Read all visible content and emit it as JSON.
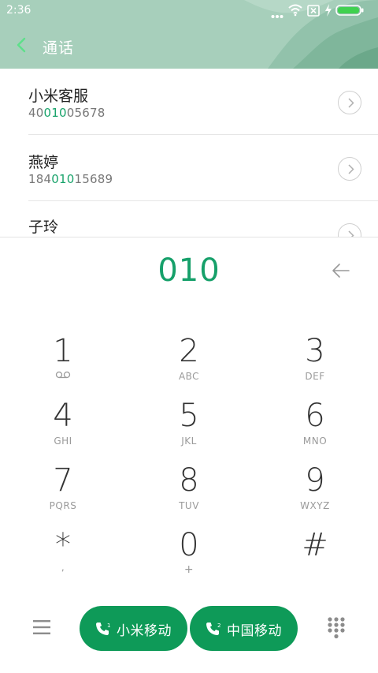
{
  "status_bar": {
    "time": "2:36",
    "icons": [
      "more-dots-icon",
      "wifi-icon",
      "sim-disabled-icon",
      "charging-bolt-icon",
      "battery-icon"
    ]
  },
  "header": {
    "title": "通话",
    "back_icon": "chevron-left-icon",
    "accent_color": "#a7cfbb"
  },
  "contacts": [
    {
      "name": "小米客服",
      "number_prefix": "40",
      "number_match": "010",
      "number_suffix": "05678"
    },
    {
      "name": "燕婷",
      "number_prefix": "184",
      "number_match": "010",
      "number_suffix": "15689"
    },
    {
      "name": "子玲",
      "number_prefix": "",
      "number_match": "",
      "number_suffix": ""
    }
  ],
  "dialer": {
    "input": "010",
    "input_color": "#16a06a",
    "keys": [
      {
        "digit": "1",
        "sub": "",
        "icon": "voicemail-icon"
      },
      {
        "digit": "2",
        "sub": "ABC"
      },
      {
        "digit": "3",
        "sub": "DEF"
      },
      {
        "digit": "4",
        "sub": "GHI"
      },
      {
        "digit": "5",
        "sub": "JKL"
      },
      {
        "digit": "6",
        "sub": "MNO"
      },
      {
        "digit": "7",
        "sub": "PQRS"
      },
      {
        "digit": "8",
        "sub": "TUV"
      },
      {
        "digit": "9",
        "sub": "WXYZ"
      },
      {
        "digit": "*",
        "sub": ","
      },
      {
        "digit": "0",
        "sub": "+"
      },
      {
        "digit": "#",
        "sub": ""
      }
    ]
  },
  "bottom_bar": {
    "call_buttons": [
      {
        "label": "小米移动",
        "sim": "1"
      },
      {
        "label": "中国移动",
        "sim": "2"
      }
    ],
    "call_color": "#0e9a58"
  }
}
